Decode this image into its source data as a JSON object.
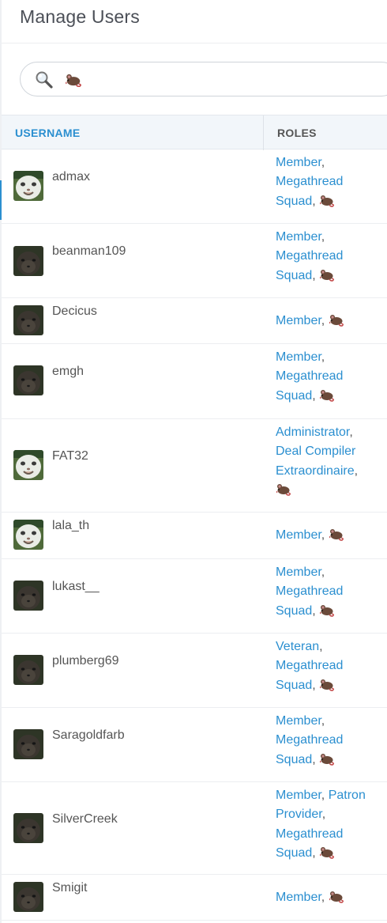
{
  "page": {
    "title": "Manage Users"
  },
  "search": {
    "value_icon": "rat-emoji",
    "icon": "magnifier-icon"
  },
  "table": {
    "columns": {
      "username": "USERNAME",
      "roles": "ROLES"
    },
    "rows": [
      {
        "username": "admax",
        "avatar": "white-cat-face",
        "roles": [
          "Member",
          "Megathread Squad"
        ],
        "rat": true
      },
      {
        "username": "beanman109",
        "avatar": "dark-cat-face",
        "roles": [
          "Member",
          "Megathread Squad"
        ],
        "rat": true
      },
      {
        "username": "Decicus",
        "avatar": "dark-cat-face",
        "roles": [
          "Member"
        ],
        "rat": true
      },
      {
        "username": "emgh",
        "avatar": "dark-cat-face",
        "roles": [
          "Member",
          "Megathread Squad"
        ],
        "rat": true
      },
      {
        "username": "FAT32",
        "avatar": "white-cat-face",
        "roles": [
          "Administrator",
          "Deal Compiler Extraordinaire"
        ],
        "rat": true
      },
      {
        "username": "lala_th",
        "avatar": "white-cat-face",
        "roles": [
          "Member"
        ],
        "rat": true
      },
      {
        "username": "lukast__",
        "avatar": "dark-cat-face",
        "roles": [
          "Member",
          "Megathread Squad"
        ],
        "rat": true
      },
      {
        "username": "plumberg69",
        "avatar": "dark-cat-face",
        "roles": [
          "Veteran",
          "Megathread Squad"
        ],
        "rat": true
      },
      {
        "username": "Saragoldfarb",
        "avatar": "dark-cat-face",
        "roles": [
          "Member",
          "Megathread Squad"
        ],
        "rat": true
      },
      {
        "username": "SilverCreek",
        "avatar": "dark-cat-face",
        "roles": [
          "Member",
          "Patron Provider",
          "Megathread Squad"
        ],
        "rat": true
      },
      {
        "username": "Smigit",
        "avatar": "dark-cat-face",
        "roles": [
          "Member"
        ],
        "rat": true
      }
    ]
  },
  "colors": {
    "accent": "#2b8fd0",
    "header_bg": "#f2f6fa",
    "text": "#555555"
  }
}
